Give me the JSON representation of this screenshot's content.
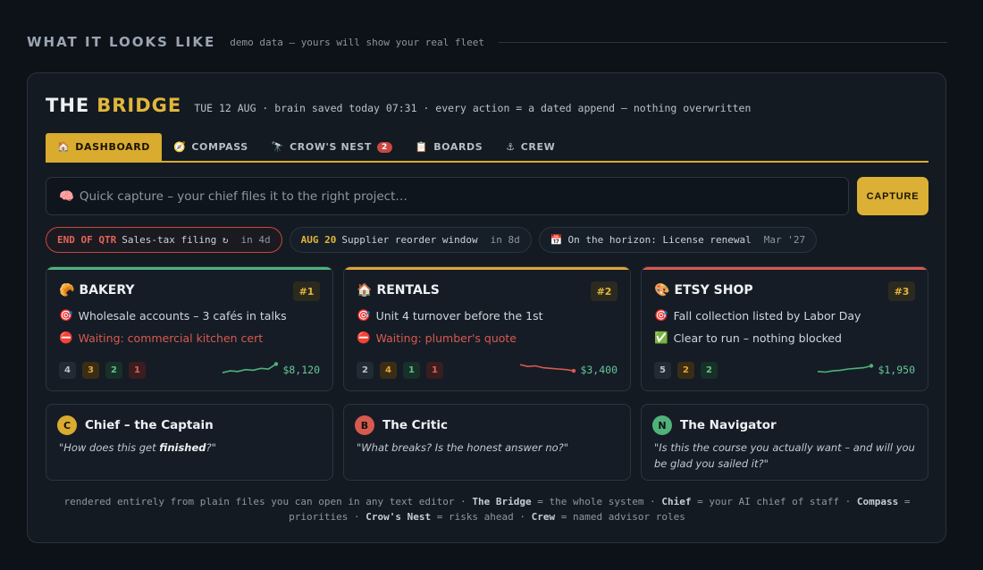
{
  "section": {
    "title": "WHAT IT LOOKS LIKE",
    "subtitle": "demo data — yours will show your real fleet"
  },
  "bridge": {
    "the": "THE",
    "name": "BRIDGE",
    "meta": "TUE 12 AUG · brain saved today 07:31 · every action = a dated append — nothing overwritten"
  },
  "tabs": [
    {
      "icon": "🏠",
      "label": "DASHBOARD"
    },
    {
      "icon": "🧭",
      "label": "COMPASS"
    },
    {
      "icon": "🔭",
      "label": "CROW'S NEST",
      "badge": "2"
    },
    {
      "icon": "📋",
      "label": "BOARDS"
    },
    {
      "icon": "⚓",
      "label": "CREW"
    }
  ],
  "capture": {
    "icon": "🧠",
    "placeholder": "Quick capture – your chief files it to the right project…",
    "button": "CAPTURE"
  },
  "alerts": [
    {
      "tag": "END OF QTR",
      "text": "Sales-tax filing ↻",
      "when": "in 4d"
    },
    {
      "tag": "AUG 20",
      "text": "Supplier reorder window",
      "when": "in 8d"
    },
    {
      "tag": "📅",
      "text": "On the horizon: License renewal",
      "when": "Mar '27"
    }
  ],
  "projects": [
    {
      "icon": "🥐",
      "name": "BAKERY",
      "rank": "#1",
      "line1_icon": "🎯",
      "line1": "Wholesale accounts – 3 cafés in talks",
      "line2_icon": "⛔",
      "line2": "Waiting: commercial kitchen cert",
      "counts": [
        "4",
        "3",
        "2",
        "1"
      ],
      "amount": "$8,120",
      "trend": [
        0.2,
        0.35,
        0.3,
        0.45,
        0.4,
        0.55,
        0.5,
        0.9
      ],
      "bar_color": "#4fb27a",
      "line_color": "#4fb27a"
    },
    {
      "icon": "🏠",
      "name": "RENTALS",
      "rank": "#2",
      "line1_icon": "🎯",
      "line1": "Unit 4 turnover before the 1st",
      "line2_icon": "⛔",
      "line2": "Waiting: plumber's quote",
      "counts": [
        "2",
        "4",
        "1",
        "1"
      ],
      "amount": "$3,400",
      "trend": [
        0.85,
        0.7,
        0.75,
        0.6,
        0.55,
        0.5,
        0.45,
        0.35
      ],
      "bar_color": "#e0a33a",
      "line_color": "#d75a50"
    },
    {
      "icon": "🎨",
      "name": "ETSY SHOP",
      "rank": "#3",
      "line1_icon": "🎯",
      "line1": "Fall collection listed by Labor Day",
      "line2_icon": "✅",
      "line2": "Clear to run – nothing blocked",
      "counts": [
        "5",
        "2",
        "2"
      ],
      "amount": "$1,950",
      "trend": [
        0.3,
        0.25,
        0.35,
        0.4,
        0.5,
        0.55,
        0.6,
        0.75
      ],
      "bar_color": "#d75a50",
      "line_color": "#4fb27a"
    }
  ],
  "advisors": [
    {
      "initial": "C",
      "name": "Chief – the Captain",
      "quote_pre": "\"How does this get ",
      "quote_bold": "finished",
      "quote_post": "?\"",
      "color": "#d9ab2e"
    },
    {
      "initial": "B",
      "name": "The Critic",
      "quote_pre": "\"What breaks? Is the honest answer no?\"",
      "quote_bold": "",
      "quote_post": "",
      "color": "#d75a50"
    },
    {
      "initial": "N",
      "name": "The Navigator",
      "quote_pre": "\"Is this the course you actually want – and will you be glad you sailed it?\"",
      "quote_bold": "",
      "quote_post": "",
      "color": "#4fb27a"
    }
  ],
  "footer": {
    "t1": "rendered entirely from plain files you can open in any text editor · ",
    "b1": "The Bridge",
    "t2": " = the whole system · ",
    "b2": "Chief",
    "t3": " = your AI chief of staff · ",
    "b3": "Compass",
    "t4": " = priorities · ",
    "b4": "Crow's Nest",
    "t5": " = risks ahead · ",
    "b5": "Crew",
    "t6": " = named advisor roles"
  }
}
